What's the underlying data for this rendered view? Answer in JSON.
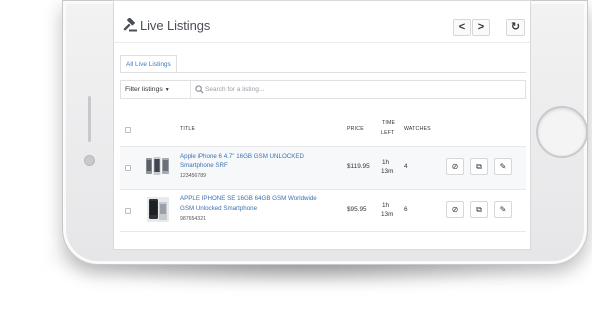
{
  "header": {
    "title": "Live Listings",
    "prev_label": "<",
    "next_label": ">",
    "refresh_label": "↻"
  },
  "tabs": [
    {
      "label": "All Live Listings",
      "active": true
    }
  ],
  "filter": {
    "label": "Filter listings",
    "caret": "▼"
  },
  "search": {
    "placeholder": "Search for a listing..."
  },
  "table": {
    "headers": {
      "title": "TITLE",
      "price": "PRICE",
      "time_left": [
        "TIME",
        "LEFT"
      ],
      "watches": "WATCHES"
    },
    "rows": [
      {
        "title": [
          "Apple iPhone 6 4.7\" 16GB GSM UNLOCKED",
          "Smartphone SRF"
        ],
        "sku": "123456789",
        "price": "$119.95",
        "time_left": [
          "1h",
          "13m"
        ],
        "watches": "4"
      },
      {
        "title": [
          "APPLE IPHONE SE 16GB 64GB GSM Worldwide",
          "GSM Unlocked Smartphone"
        ],
        "sku": "987654321",
        "price": "$95.95",
        "time_left": [
          "1h",
          "13m"
        ],
        "watches": "6"
      }
    ],
    "actions": {
      "end": "⊘",
      "copy": "⧉",
      "edit": "✎"
    }
  },
  "colors": {
    "link": "#3b7bbf",
    "border": "#dedfe2",
    "row_highlight": "#f7f8f9"
  }
}
